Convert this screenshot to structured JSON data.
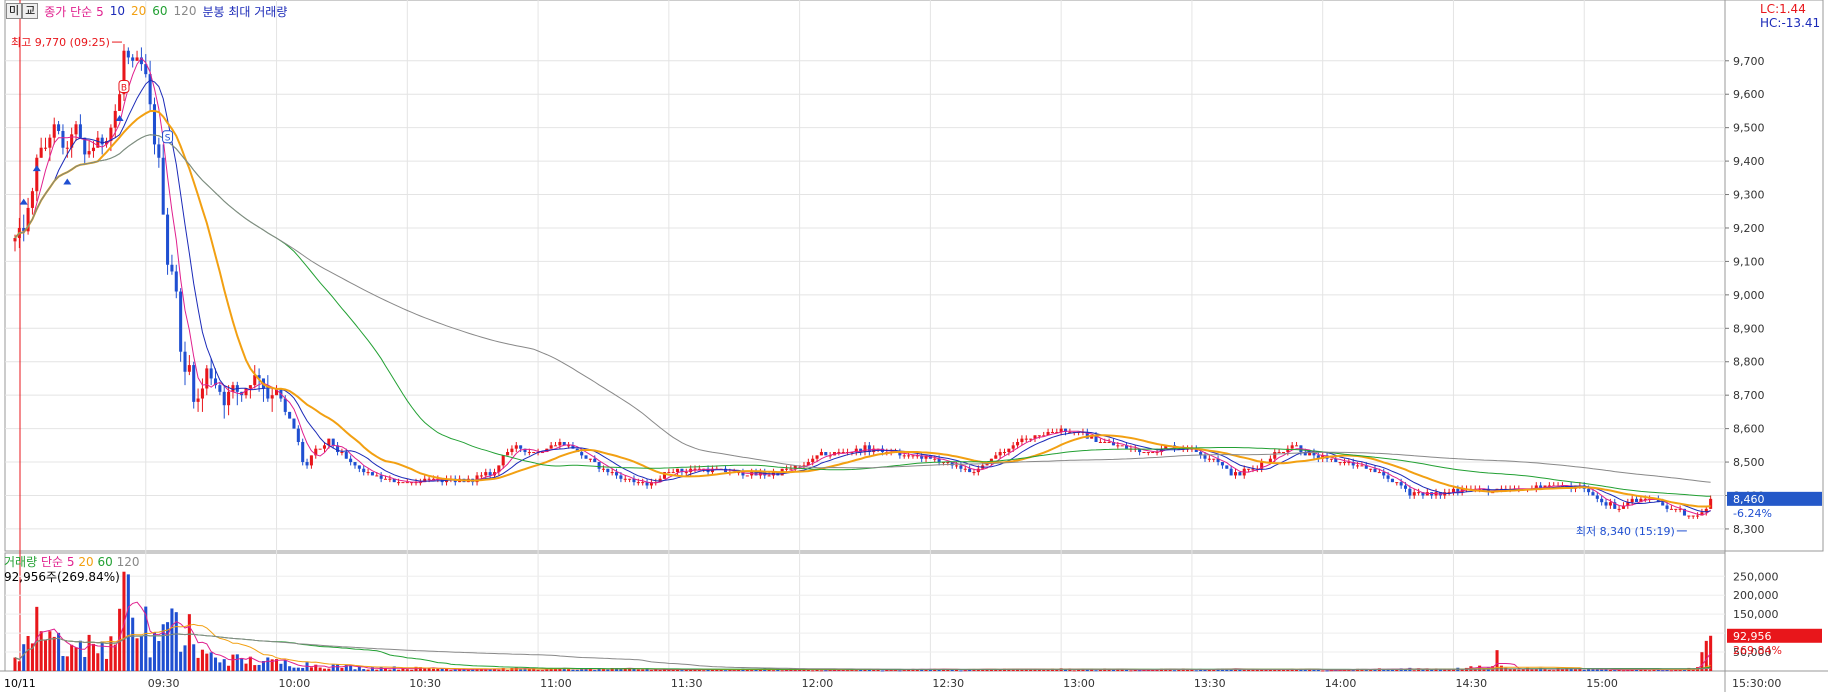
{
  "toolbar": {
    "btn1": "미",
    "btn2": "교",
    "price_label": "종가 단순",
    "ma5": "5",
    "ma10": "10",
    "ma20": "20",
    "ma60": "60",
    "ma120": "120",
    "freq_label": "분봉 최대 거래량"
  },
  "corner": {
    "lc": "LC:1.44",
    "hc": "HC:-13.41"
  },
  "colors": {
    "up": "#e8161b",
    "down": "#1f4fd1",
    "ma5": "#e0208e",
    "ma10": "#1b2ab8",
    "ma20": "#f2a012",
    "ma60": "#22a033",
    "ma120": "#888888",
    "current_tag_bg": "#2458c8",
    "volume_tag_bg": "#e8161b"
  },
  "annotations": {
    "high": "최고 9,770 (09:25)",
    "low": "최저 8,340 (15:19)",
    "buy_marker": "B",
    "sell_marker": "S",
    "current_price": "8,460",
    "current_change": "-6.24%",
    "current_volume": "92,956",
    "current_volume_pct": "269.84%"
  },
  "volume_header": {
    "label": "거래량",
    "simple": "단순",
    "ma5": "5",
    "ma20": "20",
    "ma60": "60",
    "ma120": "120",
    "value_line": "92,956주(269.84%)"
  },
  "chart_data": [
    {
      "type": "candlestick",
      "title": "",
      "date_label": "10/11",
      "x_tick_labels": [
        "09:30",
        "10:00",
        "10:30",
        "11:00",
        "11:30",
        "12:00",
        "12:30",
        "13:00",
        "13:30",
        "14:00",
        "14:30",
        "15:00",
        "15:30:00"
      ],
      "y_tick_labels": [
        "9,700",
        "9,600",
        "9,500",
        "9,400",
        "9,300",
        "9,200",
        "9,100",
        "9,000",
        "8,900",
        "8,800",
        "8,700",
        "8,600",
        "8,500",
        "8,400",
        "8,300"
      ],
      "ylim": [
        8240,
        9810
      ],
      "x_range_minutes": [
        "09:00",
        "15:30"
      ],
      "close_profile": [
        [
          0,
          9160
        ],
        [
          2,
          9200
        ],
        [
          4,
          9300
        ],
        [
          5,
          9420
        ],
        [
          7,
          9440
        ],
        [
          8,
          9480
        ],
        [
          9,
          9500
        ],
        [
          10,
          9480
        ],
        [
          12,
          9420
        ],
        [
          13,
          9490
        ],
        [
          14,
          9500
        ],
        [
          16,
          9420
        ],
        [
          18,
          9440
        ],
        [
          20,
          9460
        ],
        [
          22,
          9500
        ],
        [
          23,
          9550
        ],
        [
          24,
          9600
        ],
        [
          25,
          9730
        ],
        [
          26,
          9700
        ],
        [
          27,
          9680
        ],
        [
          28,
          9700
        ],
        [
          29,
          9690
        ],
        [
          30,
          9650
        ],
        [
          31,
          9560
        ],
        [
          32,
          9460
        ],
        [
          33,
          9400
        ],
        [
          34,
          9250
        ],
        [
          35,
          9100
        ],
        [
          36,
          9080
        ],
        [
          37,
          9000
        ],
        [
          38,
          8850
        ],
        [
          39,
          8760
        ],
        [
          40,
          8790
        ],
        [
          41,
          8700
        ],
        [
          42,
          8680
        ],
        [
          43,
          8720
        ],
        [
          44,
          8770
        ],
        [
          45,
          8760
        ],
        [
          46,
          8740
        ],
        [
          48,
          8680
        ],
        [
          50,
          8720
        ],
        [
          52,
          8710
        ],
        [
          54,
          8740
        ],
        [
          56,
          8760
        ],
        [
          58,
          8700
        ],
        [
          60,
          8720
        ],
        [
          62,
          8650
        ],
        [
          64,
          8600
        ],
        [
          65,
          8560
        ],
        [
          66,
          8500
        ],
        [
          67,
          8490
        ],
        [
          68,
          8520
        ],
        [
          70,
          8540
        ],
        [
          72,
          8560
        ],
        [
          75,
          8520
        ],
        [
          80,
          8470
        ],
        [
          85,
          8450
        ],
        [
          90,
          8440
        ],
        [
          95,
          8450
        ],
        [
          100,
          8440
        ],
        [
          105,
          8450
        ],
        [
          110,
          8470
        ],
        [
          112,
          8520
        ],
        [
          115,
          8540
        ],
        [
          120,
          8530
        ],
        [
          125,
          8560
        ],
        [
          128,
          8540
        ],
        [
          130,
          8520
        ],
        [
          135,
          8480
        ],
        [
          140,
          8450
        ],
        [
          145,
          8430
        ],
        [
          150,
          8470
        ],
        [
          155,
          8480
        ],
        [
          160,
          8480
        ],
        [
          165,
          8470
        ],
        [
          170,
          8460
        ],
        [
          175,
          8470
        ],
        [
          180,
          8490
        ],
        [
          185,
          8520
        ],
        [
          190,
          8530
        ],
        [
          195,
          8540
        ],
        [
          200,
          8530
        ],
        [
          205,
          8520
        ],
        [
          210,
          8510
        ],
        [
          215,
          8490
        ],
        [
          220,
          8470
        ],
        [
          225,
          8520
        ],
        [
          230,
          8560
        ],
        [
          235,
          8580
        ],
        [
          240,
          8600
        ],
        [
          245,
          8580
        ],
        [
          250,
          8560
        ],
        [
          255,
          8540
        ],
        [
          260,
          8530
        ],
        [
          265,
          8550
        ],
        [
          270,
          8540
        ],
        [
          272,
          8520
        ],
        [
          275,
          8510
        ],
        [
          280,
          8460
        ],
        [
          285,
          8490
        ],
        [
          290,
          8530
        ],
        [
          293,
          8550
        ],
        [
          296,
          8530
        ],
        [
          300,
          8510
        ],
        [
          305,
          8500
        ],
        [
          310,
          8480
        ],
        [
          315,
          8450
        ],
        [
          320,
          8410
        ],
        [
          325,
          8400
        ],
        [
          330,
          8420
        ],
        [
          335,
          8420
        ],
        [
          340,
          8410
        ],
        [
          345,
          8420
        ],
        [
          350,
          8430
        ],
        [
          355,
          8430
        ],
        [
          360,
          8420
        ],
        [
          363,
          8390
        ],
        [
          365,
          8380
        ],
        [
          368,
          8360
        ],
        [
          370,
          8380
        ],
        [
          375,
          8390
        ],
        [
          380,
          8360
        ],
        [
          385,
          8340
        ],
        [
          387,
          8350
        ],
        [
          390,
          8400
        ]
      ],
      "series": [
        {
          "name": "5",
          "ma_window": 5
        },
        {
          "name": "10",
          "ma_window": 10
        },
        {
          "name": "20",
          "ma_window": 20
        },
        {
          "name": "60",
          "ma_window": 60
        },
        {
          "name": "120",
          "ma_window": 120
        }
      ]
    },
    {
      "type": "bar",
      "title": "",
      "y_tick_labels": [
        "250,000",
        "200,000",
        "150,000",
        "100,000",
        "50,000"
      ],
      "ylim": [
        0,
        285000
      ],
      "volume_profile": [
        [
          0,
          60000
        ],
        [
          2,
          90000
        ],
        [
          4,
          130000
        ],
        [
          6,
          170000
        ],
        [
          8,
          140000
        ],
        [
          10,
          110000
        ],
        [
          12,
          90000
        ],
        [
          14,
          80000
        ],
        [
          16,
          100000
        ],
        [
          18,
          70000
        ],
        [
          20,
          90000
        ],
        [
          22,
          120000
        ],
        [
          24,
          150000
        ],
        [
          25,
          250000
        ],
        [
          26,
          170000
        ],
        [
          27,
          120000
        ],
        [
          28,
          160000
        ],
        [
          30,
          110000
        ],
        [
          32,
          90000
        ],
        [
          33,
          150000
        ],
        [
          34,
          130000
        ],
        [
          36,
          160000
        ],
        [
          38,
          110000
        ],
        [
          40,
          90000
        ],
        [
          42,
          60000
        ],
        [
          45,
          50000
        ],
        [
          50,
          40000
        ],
        [
          55,
          35000
        ],
        [
          60,
          30000
        ],
        [
          65,
          25000
        ],
        [
          70,
          20000
        ],
        [
          80,
          12000
        ],
        [
          100,
          8000
        ],
        [
          150,
          6000
        ],
        [
          200,
          5000
        ],
        [
          240,
          6000
        ],
        [
          300,
          5000
        ],
        [
          330,
          8000
        ],
        [
          340,
          15000
        ],
        [
          345,
          8000
        ],
        [
          380,
          5000
        ],
        [
          385,
          9000
        ],
        [
          389,
          92956
        ]
      ],
      "spikes": [
        [
          6,
          105000
        ],
        [
          25,
          262000
        ],
        [
          26,
          255000
        ],
        [
          30,
          170000
        ],
        [
          36,
          165000
        ],
        [
          40,
          150000
        ],
        [
          340,
          55000
        ],
        [
          389,
          92956
        ]
      ]
    }
  ]
}
